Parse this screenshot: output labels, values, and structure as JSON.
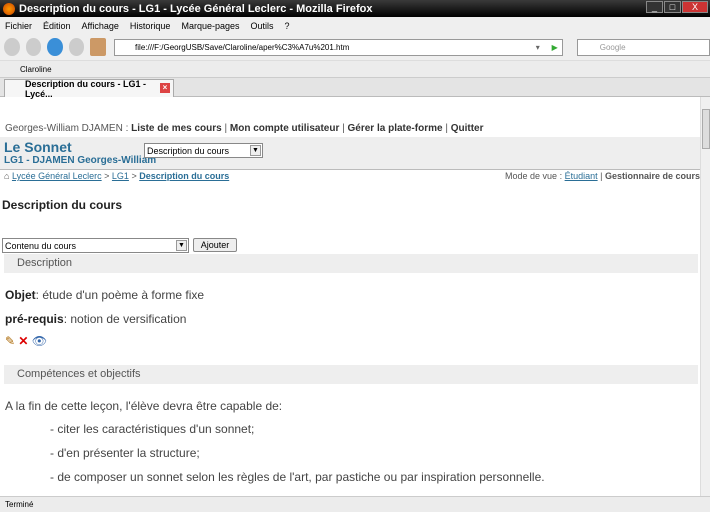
{
  "window": {
    "title": "Description du cours - LG1 - Lycée Général Leclerc - Mozilla Firefox"
  },
  "menu": [
    "Fichier",
    "Édition",
    "Affichage",
    "Historique",
    "Marque-pages",
    "Outils",
    "?"
  ],
  "nav": {
    "url": "file:///F:/GeorgUSB/Save/Claroline/aper%C3%A7u%201.htm",
    "search_placeholder": "Google"
  },
  "bookmarks": [
    "Claroline"
  ],
  "tab": {
    "label": "Description du cours - LG1 - Lycé..."
  },
  "page": {
    "user": "Georges-William DJAMEN :",
    "user_links": [
      "Liste de mes cours",
      "Mon compte utilisateur",
      "Gérer la plate-forme",
      "Quitter"
    ],
    "course_title": "Le Sonnet",
    "course_sub": "LG1 - DJAMEN Georges-William",
    "tool_select": "Description du cours",
    "breadcrumb": [
      "Lycée Général Leclerc",
      "LG1",
      "Description du cours"
    ],
    "mode_label": "Mode de vue :",
    "mode_student": "Étudiant",
    "mode_manager": "Gestionnaire de cours",
    "heading": "Description du cours",
    "content_select": "Contenu du cours",
    "add_button": "Ajouter",
    "sections": [
      {
        "title": "Description",
        "lines": [
          {
            "label": "Objet",
            "text": ": étude d'un poème à forme fixe"
          },
          {
            "label": "pré-requis",
            "text": ": notion de versification"
          }
        ]
      },
      {
        "title": "Compétences et objectifs",
        "intro": "A la fin de cette leçon, l'élève devra être capable de:",
        "items": [
          "- citer les caractéristiques d'un sonnet;",
          "- d'en présenter la structure;",
          "- de composer un sonnet selon les règles de l'art, par pastiche ou par inspiration personnelle."
        ]
      }
    ]
  },
  "status": "Terminé"
}
